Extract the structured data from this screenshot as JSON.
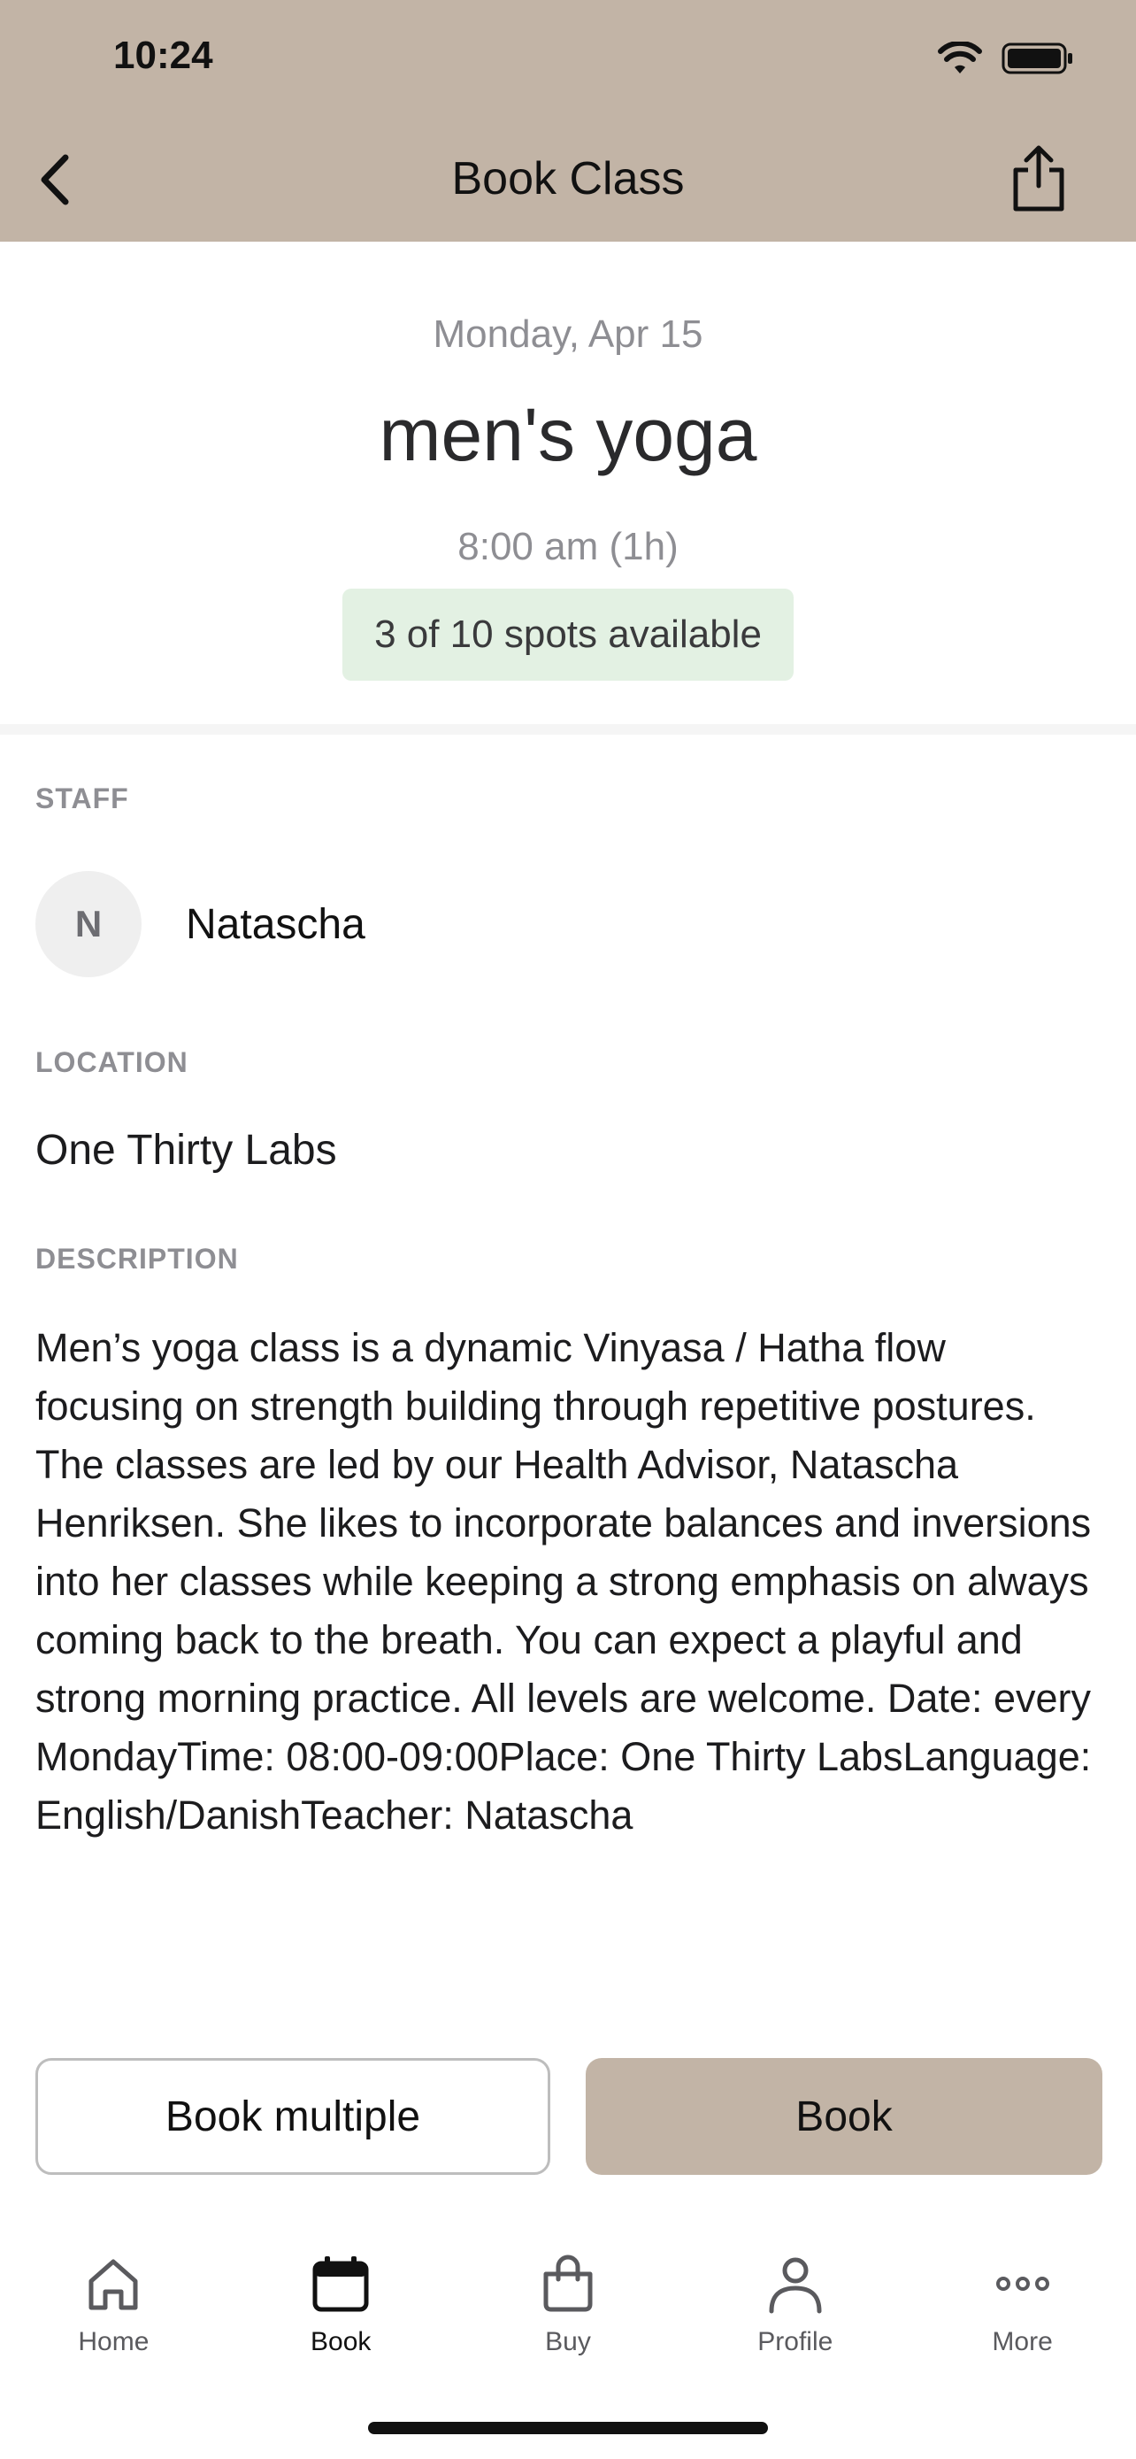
{
  "status_bar": {
    "time": "10:24",
    "icons": [
      "wifi-icon",
      "battery-icon"
    ]
  },
  "header": {
    "title": "Book Class",
    "back_icon": "chevron-left-icon",
    "share_icon": "share-icon"
  },
  "class": {
    "date": "Monday, Apr 15",
    "title": "men's yoga",
    "time": "8:00 am (1h)",
    "spots": "3 of 10 spots available"
  },
  "sections": {
    "staff_label": "STAFF",
    "staff_initial": "N",
    "staff_name": "Natascha",
    "location_label": "LOCATION",
    "location": "One Thirty Labs",
    "description_label": "DESCRIPTION",
    "description": "Men’s yoga class is a dynamic Vinyasa / Hatha flow focusing on strength building through repetitive postures. The classes are led by our Health Advisor, Natascha Henriksen. She likes to incorporate balances and inversions into her classes while keeping a strong emphasis on always coming back to the breath. You can expect a playful and strong morning practice. All levels are welcome.   Date: every MondayTime: 08:00-09:00Place: One Thirty LabsLanguage: English/DanishTeacher: Natascha"
  },
  "actions": {
    "book_multiple": "Book multiple",
    "book": "Book"
  },
  "tabbar": {
    "items": [
      {
        "label": "Home",
        "icon": "home-icon"
      },
      {
        "label": "Book",
        "icon": "calendar-icon",
        "active": true
      },
      {
        "label": "Buy",
        "icon": "shopping-bag-icon"
      },
      {
        "label": "Profile",
        "icon": "person-icon"
      },
      {
        "label": "More",
        "icon": "more-dots-icon"
      }
    ]
  },
  "colors": {
    "brand": "#c2b4a6",
    "spots_bg": "#e3f1e3"
  }
}
